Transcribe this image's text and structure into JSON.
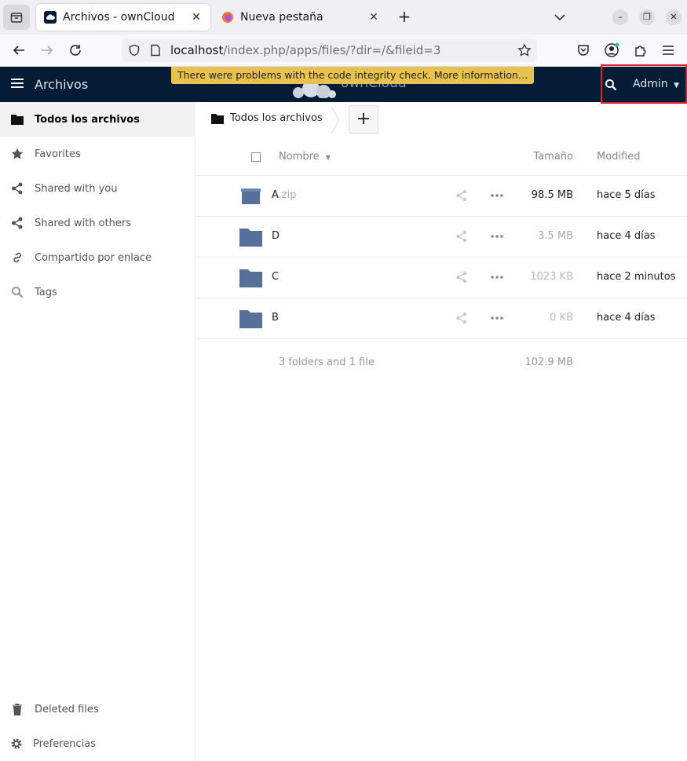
{
  "browser": {
    "tabs": [
      {
        "title": "Archivos - ownCloud",
        "active": true
      },
      {
        "title": "Nueva pestaña",
        "active": false
      }
    ],
    "url": {
      "host": "localhost",
      "path": "/index.php/apps/files/?dir=/&fileid=3"
    }
  },
  "header": {
    "app_title": "Archivos",
    "logo_text": "ownCloud",
    "warning": "There were problems with the code integrity check. More information…",
    "user": "Admin"
  },
  "sidebar": {
    "items": [
      {
        "label": "Todos los archivos",
        "icon": "folder-icon"
      },
      {
        "label": "Favorites",
        "icon": "star-icon"
      },
      {
        "label": "Shared with you",
        "icon": "share-icon"
      },
      {
        "label": "Shared with others",
        "icon": "share-icon"
      },
      {
        "label": "Compartido por enlace",
        "icon": "link-icon"
      },
      {
        "label": "Tags",
        "icon": "search-icon"
      }
    ],
    "bottom": [
      {
        "label": "Deleted files",
        "icon": "trash-icon"
      },
      {
        "label": "Preferencias",
        "icon": "gear-icon"
      }
    ]
  },
  "breadcrumb": {
    "label": "Todos los archivos"
  },
  "table": {
    "headers": {
      "name": "Nombre",
      "size": "Tamaño",
      "modified": "Modified"
    },
    "rows": [
      {
        "name": "A",
        "ext": ".zip",
        "size": "98.5 MB",
        "modified": "hace 5 días",
        "type": "zip"
      },
      {
        "name": "D",
        "ext": "",
        "size": "3.5 MB",
        "modified": "hace 4 días",
        "type": "folder"
      },
      {
        "name": "C",
        "ext": "",
        "size": "1023 KB",
        "modified": "hace 2 minutos",
        "type": "folder"
      },
      {
        "name": "B",
        "ext": "",
        "size": "0 KB",
        "modified": "hace 4 días",
        "type": "folder"
      }
    ],
    "summary": {
      "count": "3 folders and 1 file",
      "total": "102.9 MB"
    }
  },
  "colors": {
    "header_bg": "#051c36",
    "folder": "#56709a",
    "warning": "#e8c24e",
    "highlight": "#e01b24"
  }
}
